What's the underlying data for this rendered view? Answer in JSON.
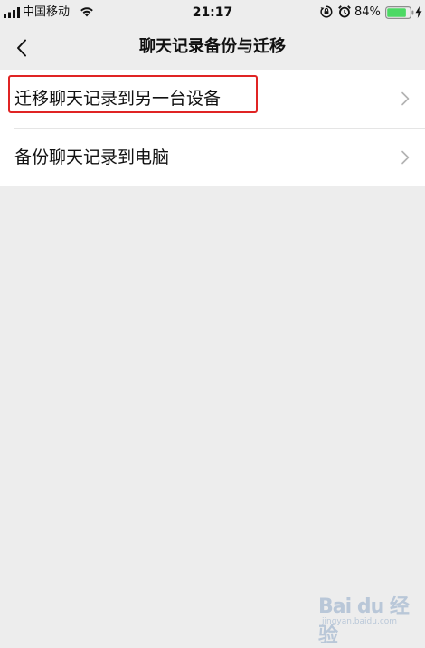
{
  "status_bar": {
    "carrier": "中国移动",
    "time": "21:17",
    "battery_percent": "84%",
    "battery_level": 0.84,
    "icons": [
      "signal-icon",
      "wifi-icon",
      "rotation-lock-icon",
      "alarm-icon",
      "battery-icon",
      "charging-icon"
    ]
  },
  "nav": {
    "title": "聊天记录备份与迁移",
    "back_icon": "chevron-left-icon"
  },
  "list": {
    "items": [
      {
        "label": "迁移聊天记录到另一台设备",
        "icon": "chevron-right-icon",
        "highlighted": true
      },
      {
        "label": "备份聊天记录到电脑",
        "icon": "chevron-right-icon",
        "highlighted": false
      }
    ]
  },
  "colors": {
    "background": "#ededed",
    "list_background": "#ffffff",
    "highlight_border": "#e02424",
    "battery_fill": "#4cd964"
  },
  "watermark": {
    "text": "Bai du 经验",
    "sub": "jingyan.baidu.com"
  }
}
